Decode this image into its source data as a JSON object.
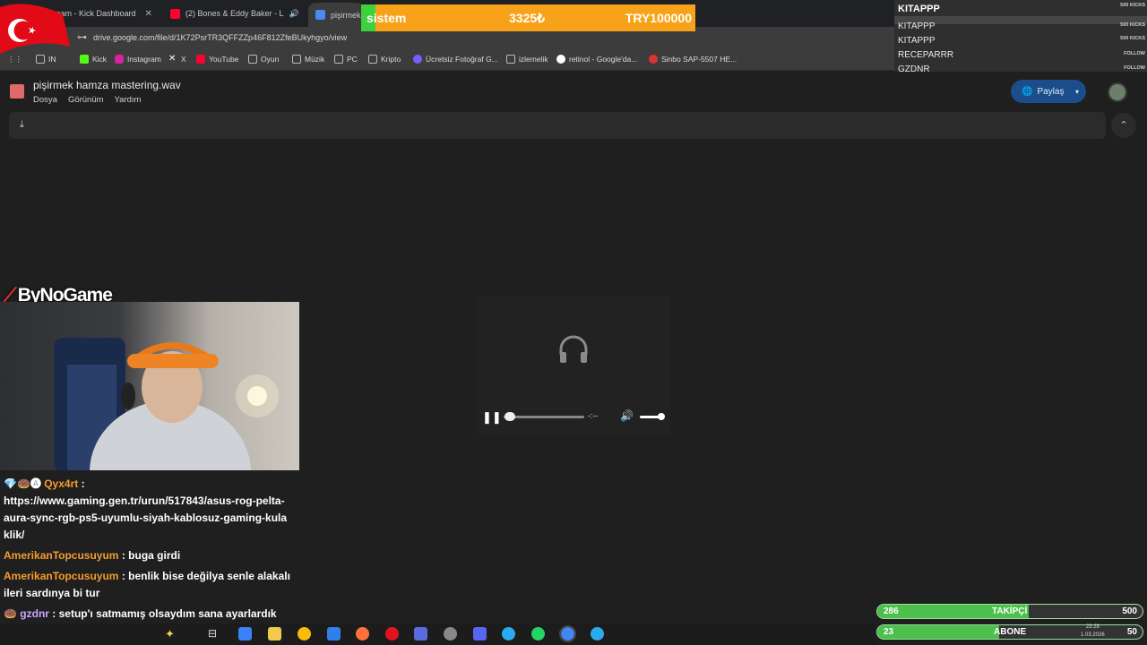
{
  "browser": {
    "tabs": [
      {
        "label": "Stream - Kick Dashboard",
        "color": "#53fc18"
      },
      {
        "label": "(2) Bones & Eddy Baker - L",
        "color": "#ff0033"
      },
      {
        "label": "pişirmek h",
        "color": "#4a8af4"
      }
    ],
    "url": "drive.google.com/file/d/1K72PsrTR3QFFZZp46F812ZfeBUkyhgyo/view",
    "bookmarks": [
      "IN",
      "Kick",
      "Instagram",
      "X",
      "YouTube",
      "Oyun",
      "Müzik",
      "PC",
      "Kripto",
      "Ücretsiz Fotoğraf G...",
      "izlemelik",
      "retinol - Google'da...",
      "Sinbo SAP-5507 HE..."
    ]
  },
  "overlay": {
    "donation_name": "sistem",
    "donation_amount": "3325₺",
    "donation_goal": "TRY100000",
    "panel_title": "KITAPPP",
    "panel_top_right": "500 KICKS",
    "panel_rows": [
      {
        "name": "KITAPPP",
        "right": "500 KICKS"
      },
      {
        "name": "KITAPPP",
        "right": "500 KICKS"
      },
      {
        "name": "RECEPARRR",
        "right": "FOLLOW"
      },
      {
        "name": "GZDNR",
        "right": "FOLLOW"
      }
    ],
    "brand": "ByNoGame",
    "followers": {
      "current": "286",
      "label": "TAKİPÇİ",
      "goal": "500",
      "progress": 0.572
    },
    "subs": {
      "current": "23",
      "label": "ABONE",
      "goal": "50",
      "progress": 0.46
    }
  },
  "drive": {
    "file_name": "pişirmek hamza mastering.wav",
    "menus": [
      "Dosya",
      "Görünüm",
      "Yardım"
    ],
    "share_label": "Paylaş"
  },
  "player": {
    "time": "-:--",
    "progress": 0.0
  },
  "chat": [
    {
      "user": "Qyx4rt",
      "text": ":",
      "extra": "https://www.gaming.gen.tr/urun/517843/asus-rog-pelta-aura-sync-rgb-ps5-uyumlu-siyah-kablosuz-gaming-kulaklik/"
    },
    {
      "user": "AmerikanTopcusuyum",
      "text": ": buga girdi",
      "extra": ""
    },
    {
      "user": "AmerikanTopcusuyum",
      "text": ": benlik bise değilya senle alakalı ileri sardınya bi tur",
      "extra": ""
    },
    {
      "user": "gzdnr",
      "text": ": setup'ı satmamış olsaydım sana ayarlardık kvşsjgsşgkel",
      "extra": ""
    }
  ],
  "taskbar": {
    "time": "23:28",
    "date": "1.03.2026"
  },
  "colors": {
    "accent": "#1a4d8a",
    "donation": "#f8a21a",
    "progress_green": "#4cbf4c"
  }
}
